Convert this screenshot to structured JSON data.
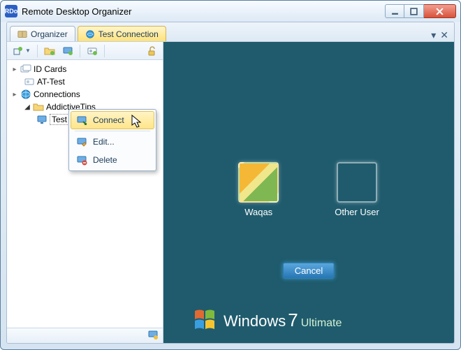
{
  "window": {
    "title": "Remote Desktop Organizer",
    "icon_label": "RDo"
  },
  "tabs": [
    {
      "label": "Organizer",
      "active": false
    },
    {
      "label": "Test Connection",
      "active": true
    }
  ],
  "tree": {
    "idcards": {
      "label": "ID Cards"
    },
    "at_test": {
      "label": "AT-Test"
    },
    "connections": {
      "label": "Connections"
    },
    "addictivetips": {
      "label": "AddictiveTips"
    },
    "testconnection": {
      "label": "Test Connection"
    }
  },
  "context_menu": {
    "connect": "Connect",
    "edit": "Edit...",
    "delete": "Delete"
  },
  "remote": {
    "users": [
      {
        "name": "Waqas"
      },
      {
        "name": "Other User"
      }
    ],
    "cancel": "Cancel",
    "brand_main": "Windows",
    "brand_version": "7",
    "brand_edition": "Ultimate"
  }
}
